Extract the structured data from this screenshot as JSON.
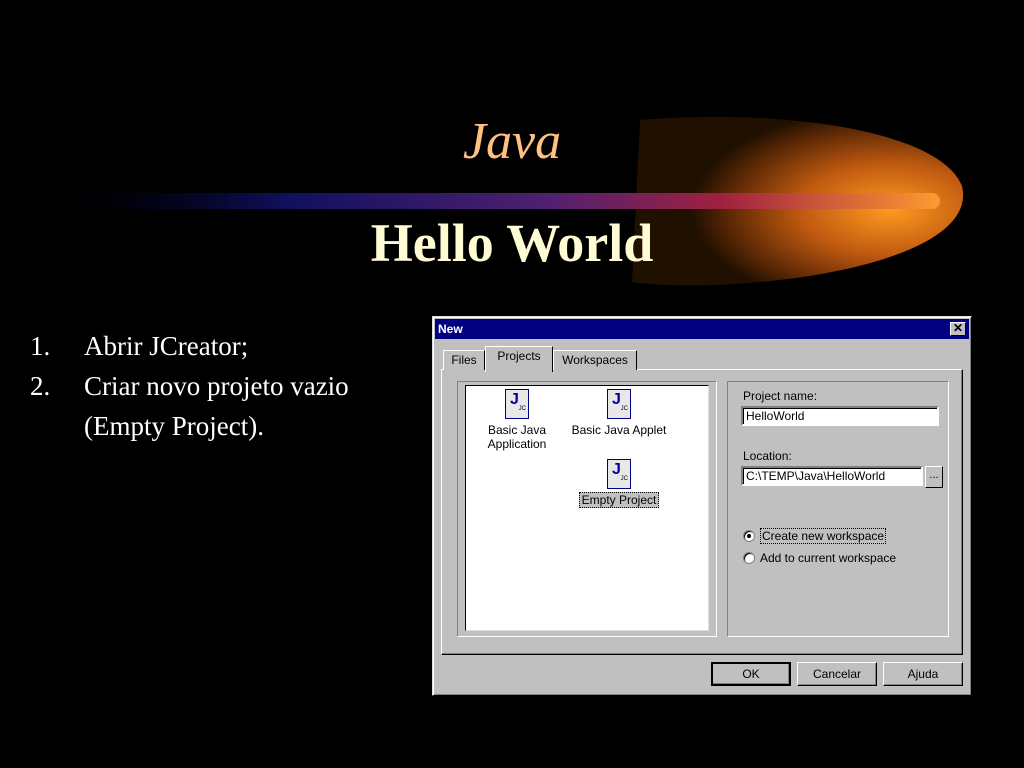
{
  "slide": {
    "title": "Java",
    "subtitle": "Hello World",
    "steps": [
      {
        "number": "1.",
        "text": "Abrir JCreator;"
      },
      {
        "number": "2.",
        "text": "Criar novo projeto vazio (Empty Project)."
      }
    ]
  },
  "dialog": {
    "title": "New",
    "close_glyph": "✕",
    "tabs": [
      "Files",
      "Projects",
      "Workspaces"
    ],
    "active_tab": "Projects",
    "projects": [
      {
        "label": "Basic Java Application",
        "icon": "jcreator-project-icon"
      },
      {
        "label": "Basic Java Applet",
        "icon": "jcreator-project-icon"
      },
      {
        "label": "Empty Project",
        "icon": "jcreator-project-icon",
        "selected": true
      }
    ],
    "project_name_label": "Project name:",
    "project_name_value": "HelloWorld",
    "location_label": "Location:",
    "location_value": "C:\\TEMP\\Java\\HelloWorld",
    "browse_label": "...",
    "radio_create": "Create new workspace",
    "radio_add": "Add to current workspace",
    "buttons": {
      "ok": "OK",
      "cancel": "Cancelar",
      "help": "Ajuda"
    }
  },
  "colors": {
    "title": "#ffc080",
    "subtitle": "#fffcd4",
    "titlebar": "#000080",
    "dialog_face": "#c0c0c0"
  }
}
